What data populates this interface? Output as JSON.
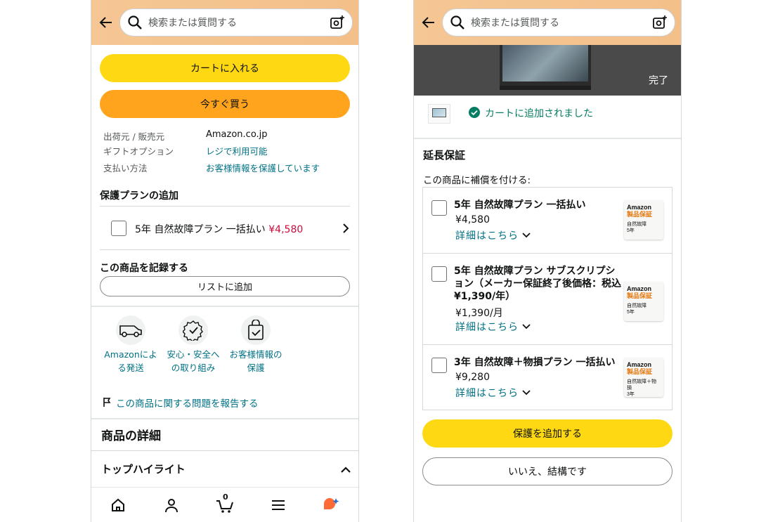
{
  "search": {
    "placeholder": "検索または質問する"
  },
  "left": {
    "add_to_cart": "カートに入れる",
    "buy_now": "今すぐ買う",
    "info": [
      {
        "label": "出荷元 / 販売元",
        "value": "Amazon.co.jp"
      },
      {
        "label": "ギフトオプション",
        "value": "レジで利用可能"
      },
      {
        "label": "支払い方法",
        "value": "お客様情報を保護しています"
      }
    ],
    "protection_heading": "保護プランの追加",
    "protection_option": {
      "label": "5年 自然故障プラン 一括払い",
      "price": "¥4,580"
    },
    "record_heading": "この商品を記録する",
    "add_to_list": "リストに追加",
    "features": [
      {
        "icon": "delivery-van-icon",
        "label": "Amazonによる発送"
      },
      {
        "icon": "safety-badge-icon",
        "label": "安心・安全への取り組み"
      },
      {
        "icon": "secure-bag-icon",
        "label": "お客様情報の保護"
      }
    ],
    "report_link": "この商品に関する問題を報告する",
    "details_heading": "商品の詳細",
    "top_highlights": "トップハイライト",
    "nav": [
      "home-icon",
      "account-icon",
      "cart-icon",
      "menu-icon",
      "assistant-icon"
    ],
    "cart_count": "0"
  },
  "right": {
    "done": "完了",
    "added_message": "カートに追加されました",
    "warranty_heading": "延長保証",
    "warranty_sub": "この商品に補償を付ける:",
    "plans": [
      {
        "title": "5年 自然故障プラン 一括払い",
        "price": "¥4,580",
        "details": "詳細はこちら",
        "badge_brand": "Amazon",
        "badge_title": "製品保証",
        "badge_desc": "自然故障",
        "badge_years": "5年"
      },
      {
        "title": "5年 自然故障プラン サブスクリプション（メーカー保証終了後価格：税込 ¥1,390/年）",
        "price": "¥1,390/月",
        "details": "詳細はこちら",
        "badge_brand": "Amazon",
        "badge_title": "製品保証",
        "badge_desc": "自然故障",
        "badge_years": "5年"
      },
      {
        "title": "3年 自然故障＋物損プラン 一括払い",
        "price": "¥9,280",
        "details": "詳細はこちら",
        "badge_brand": "Amazon",
        "badge_title": "製品保証",
        "badge_desc": "自然故障＋物損",
        "badge_years": "3年"
      }
    ],
    "add_protection": "保護を追加する",
    "no_thanks": "いいえ、結構です"
  },
  "colors": {
    "topbar": "#f3c08a",
    "yellow": "#ffd814",
    "orange": "#ffa41c",
    "link": "#007185",
    "price": "#cc0c39",
    "success": "#067d62"
  }
}
